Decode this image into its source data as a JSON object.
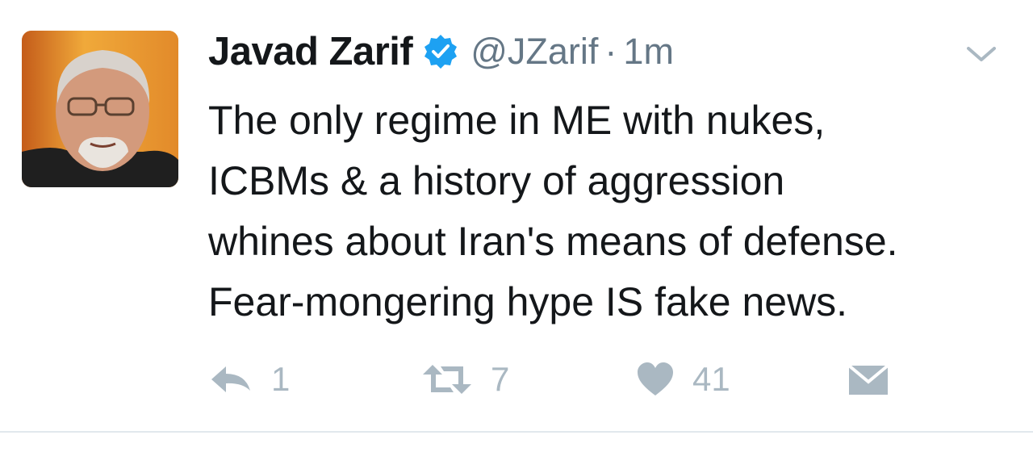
{
  "user": {
    "name": "Javad Zarif",
    "handle": "@JZarif",
    "separator": "·",
    "time": "1m",
    "avatar_icon": "profile-photo",
    "verified_icon": "verified-badge-icon",
    "verified_color": "#1da1f2"
  },
  "tweet": {
    "lines": [
      "The only regime in ME with nukes,",
      "ICBMs & a history of aggression",
      "whines about Iran's means of defense.",
      "Fear-mongering hype IS fake news."
    ]
  },
  "actions": {
    "reply": {
      "icon": "reply-icon",
      "count": "1"
    },
    "retweet": {
      "icon": "retweet-icon",
      "count": "7"
    },
    "like": {
      "icon": "heart-icon",
      "count": "41"
    },
    "dm": {
      "icon": "envelope-icon"
    }
  },
  "menu": {
    "icon": "chevron-down-icon"
  },
  "colors": {
    "text": "#14171a",
    "secondary": "#657786",
    "action_gray": "#aab8c2",
    "divider": "#e1e8ed"
  }
}
